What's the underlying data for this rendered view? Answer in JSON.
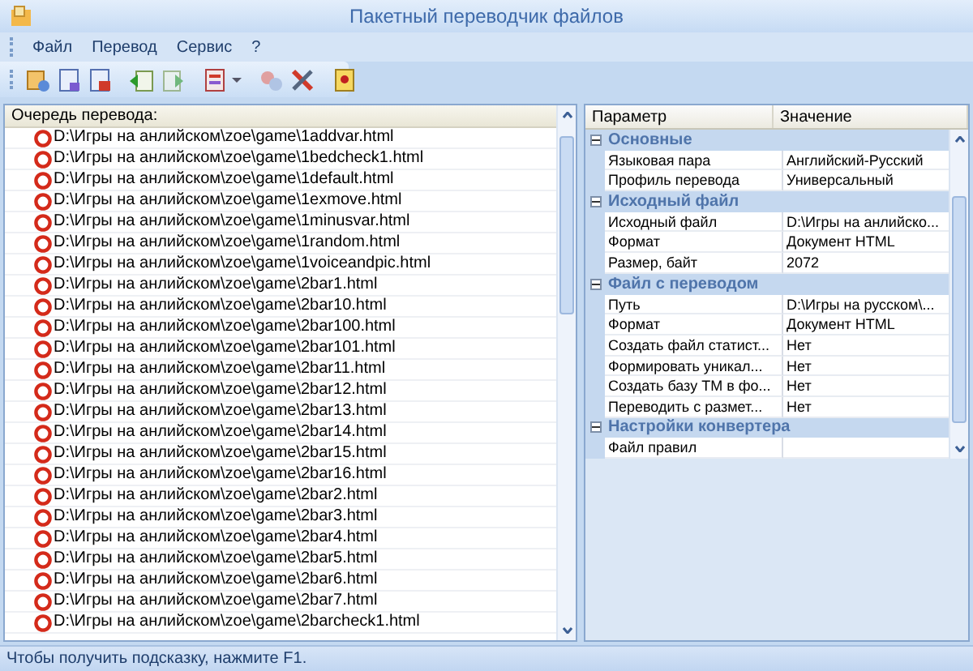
{
  "window": {
    "title": "Пакетный переводчик файлов"
  },
  "menu": [
    "Файл",
    "Перевод",
    "Сервис",
    "?"
  ],
  "queue": {
    "heading": "Очередь перевода:",
    "files": [
      "D:\\Игры на анлийском\\zoe\\game\\1addvar.html",
      "D:\\Игры на анлийском\\zoe\\game\\1bedcheck1.html",
      "D:\\Игры на анлийском\\zoe\\game\\1default.html",
      "D:\\Игры на анлийском\\zoe\\game\\1exmove.html",
      "D:\\Игры на анлийском\\zoe\\game\\1minusvar.html",
      "D:\\Игры на анлийском\\zoe\\game\\1random.html",
      "D:\\Игры на анлийском\\zoe\\game\\1voiceandpic.html",
      "D:\\Игры на анлийском\\zoe\\game\\2bar1.html",
      "D:\\Игры на анлийском\\zoe\\game\\2bar10.html",
      "D:\\Игры на анлийском\\zoe\\game\\2bar100.html",
      "D:\\Игры на анлийском\\zoe\\game\\2bar101.html",
      "D:\\Игры на анлийском\\zoe\\game\\2bar11.html",
      "D:\\Игры на анлийском\\zoe\\game\\2bar12.html",
      "D:\\Игры на анлийском\\zoe\\game\\2bar13.html",
      "D:\\Игры на анлийском\\zoe\\game\\2bar14.html",
      "D:\\Игры на анлийском\\zoe\\game\\2bar15.html",
      "D:\\Игры на анлийском\\zoe\\game\\2bar16.html",
      "D:\\Игры на анлийском\\zoe\\game\\2bar2.html",
      "D:\\Игры на анлийском\\zoe\\game\\2bar3.html",
      "D:\\Игры на анлийском\\zoe\\game\\2bar4.html",
      "D:\\Игры на анлийском\\zoe\\game\\2bar5.html",
      "D:\\Игры на анлийском\\zoe\\game\\2bar6.html",
      "D:\\Игры на анлийском\\zoe\\game\\2bar7.html",
      "D:\\Игры на анлийском\\zoe\\game\\2barcheck1.html"
    ]
  },
  "properties": {
    "columns": [
      "Параметр",
      "Значение"
    ],
    "categories": [
      {
        "name": "Основные",
        "expanded": true,
        "rows": [
          {
            "name": "Языковая пара",
            "value": "Английский-Русский"
          },
          {
            "name": "Профиль перевода",
            "value": "Универсальный"
          }
        ]
      },
      {
        "name": "Исходный файл",
        "expanded": true,
        "rows": [
          {
            "name": "Исходный файл",
            "value": "D:\\Игры на анлийско..."
          },
          {
            "name": "Формат",
            "value": "Документ HTML"
          },
          {
            "name": "Размер, байт",
            "value": "2072"
          }
        ]
      },
      {
        "name": "Файл с переводом",
        "expanded": true,
        "rows": [
          {
            "name": "Путь",
            "value": "D:\\Игры на русском\\..."
          },
          {
            "name": "Формат",
            "value": "Документ HTML"
          },
          {
            "name": "Создать файл статист...",
            "value": "Нет"
          },
          {
            "name": "Формировать уникал...",
            "value": "Нет"
          },
          {
            "name": "Создать базу ТМ в фо...",
            "value": "Нет"
          },
          {
            "name": "Переводить с размет...",
            "value": "Нет"
          }
        ]
      },
      {
        "name": "Настройки конвертера",
        "expanded": true,
        "rows": [
          {
            "name": "Файл правил"
          }
        ]
      }
    ]
  },
  "status_bar": "Чтобы получить подсказку, нажмите F1."
}
